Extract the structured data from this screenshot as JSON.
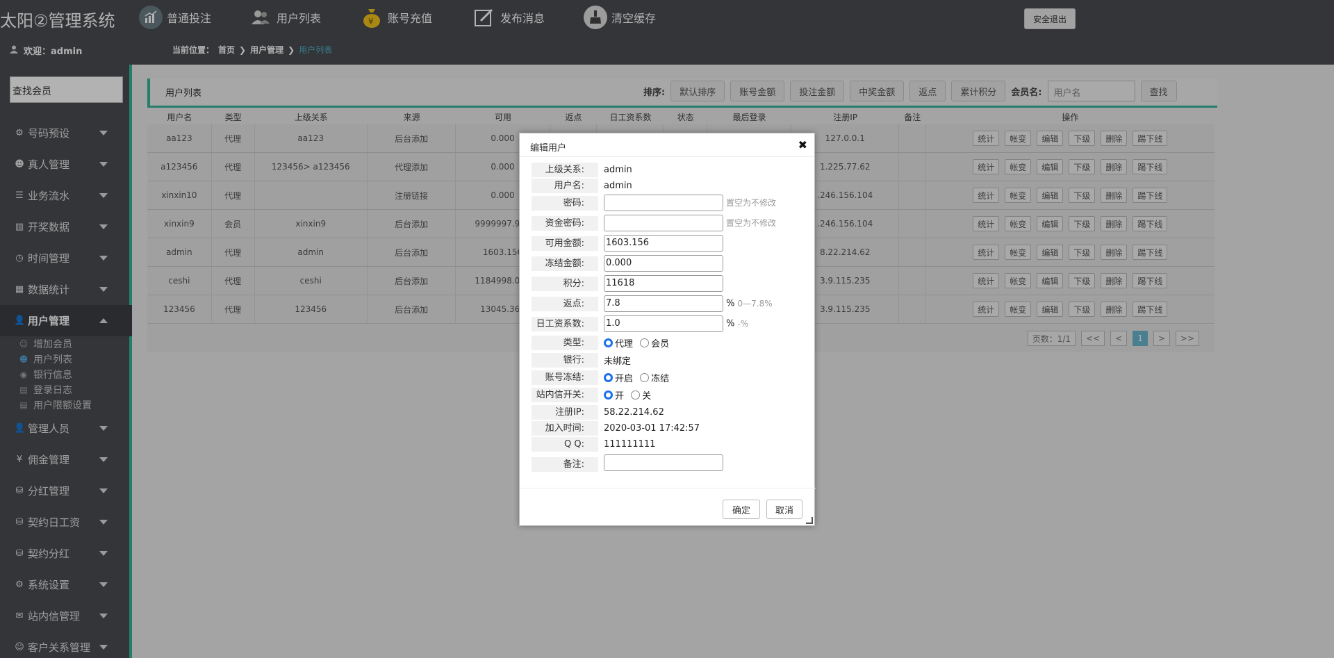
{
  "header": {
    "brand": "太阳②管理系统",
    "nav": [
      {
        "label": "普通投注",
        "icon": "chart-icon"
      },
      {
        "label": "用户列表",
        "icon": "users-icon"
      },
      {
        "label": "账号充值",
        "icon": "money-bag-icon"
      },
      {
        "label": "发布消息",
        "icon": "edit-icon"
      },
      {
        "label": "清空缓存",
        "icon": "broom-icon"
      }
    ],
    "logout": "安全退出",
    "welcome": "欢迎：admin",
    "breadcrumb": {
      "prefix": "当前位置：",
      "home": "首页",
      "section": "用户管理",
      "current": "用户列表"
    }
  },
  "sidebar": {
    "search_label": "查找会员",
    "menu": [
      {
        "label": "号码预设",
        "icon": "gear-icon"
      },
      {
        "label": "真人管理",
        "icon": "people-icon"
      },
      {
        "label": "业务流水",
        "icon": "list-icon"
      },
      {
        "label": "开奖数据",
        "icon": "bar-chart-icon"
      },
      {
        "label": "时间管理",
        "icon": "clock-icon"
      },
      {
        "label": "数据统计",
        "icon": "stats-icon"
      },
      {
        "label": "用户管理",
        "icon": "user-icon"
      },
      {
        "label": "管理人员",
        "icon": "admin-icon"
      },
      {
        "label": "佣金管理",
        "icon": "yen-icon"
      },
      {
        "label": "分红管理",
        "icon": "database-icon"
      },
      {
        "label": "契约日工资",
        "icon": "database-icon"
      },
      {
        "label": "契约分红",
        "icon": "database-icon"
      },
      {
        "label": "系统设置",
        "icon": "gear-icon"
      },
      {
        "label": "站内信管理",
        "icon": "mail-icon"
      },
      {
        "label": "客户关系管理",
        "icon": "contacts-icon"
      }
    ],
    "submenu": [
      {
        "label": "增加会员",
        "icon": "add-user-icon"
      },
      {
        "label": "用户列表",
        "icon": "user-icon"
      },
      {
        "label": "银行信息",
        "icon": "bank-icon"
      },
      {
        "label": "登录日志",
        "icon": "log-icon"
      },
      {
        "label": "用户限额设置",
        "icon": "limit-icon"
      }
    ]
  },
  "panel": {
    "title": "用户列表",
    "sort_label": "排序:",
    "sort_buttons": [
      "默认排序",
      "账号金额",
      "投注金额",
      "中奖金额",
      "返点",
      "累计积分"
    ],
    "member_label": "会员名:",
    "member_placeholder": "用户名",
    "search_button": "查找"
  },
  "table": {
    "headers": [
      "用户名",
      "类型",
      "上级关系",
      "来源",
      "可用",
      "返点",
      "日工资系数",
      "状态",
      "最后登录",
      "注册IP",
      "备注",
      "操作"
    ],
    "rows": [
      {
        "username": "aa123",
        "type": "代理",
        "parent": "aa123",
        "source": "后台添加",
        "balance": "0.000",
        "ip": "127.0.0.1"
      },
      {
        "username": "a123456",
        "type": "代理",
        "parent": "123456> a123456",
        "source": "代理添加",
        "balance": "0.000",
        "ip": "1.225.77.62"
      },
      {
        "username": "xinxin10",
        "type": "代理",
        "parent": "",
        "source": "注册链接",
        "balance": "0.000",
        "ip": ".246.156.104"
      },
      {
        "username": "xinxin9",
        "type": "会员",
        "parent": "xinxin9",
        "source": "后台添加",
        "balance": "9999997.999",
        "ip": ".246.156.104"
      },
      {
        "username": "admin",
        "type": "代理",
        "parent": "admin",
        "source": "后台添加",
        "balance": "1603.156",
        "ip": "8.22.214.62"
      },
      {
        "username": "ceshi",
        "type": "代理",
        "parent": "ceshi",
        "source": "后台添加",
        "balance": "1184998.000",
        "ip": "3.9.115.235"
      },
      {
        "username": "123456",
        "type": "代理",
        "parent": "123456",
        "source": "后台添加",
        "balance": "13045.360",
        "ip": "3.9.115.235"
      }
    ],
    "ops": [
      "统计",
      "帐变",
      "编辑",
      "下级",
      "删除",
      "踢下线"
    ]
  },
  "pager": {
    "info": "页数：1/1",
    "first": "<<",
    "prev": "<",
    "page": "1",
    "next": ">",
    "last": ">>"
  },
  "modal": {
    "title": "编辑用户",
    "close": "✖",
    "parent_label": "上级关系:",
    "parent_value": "admin",
    "username_label": "用户名:",
    "username_value": "admin",
    "password_label": "密码:",
    "password_hint": "置空为不修改",
    "fund_password_label": "资金密码:",
    "fund_password_hint": "置空为不修改",
    "available_label": "可用金额:",
    "available_value": "1603.156",
    "frozen_label": "冻结金额:",
    "frozen_value": "0.000",
    "points_label": "积分:",
    "points_value": "11618",
    "rebate_label": "返点:",
    "rebate_value": "7.8",
    "rebate_unit": "%",
    "rebate_hint": "0—7.8%",
    "wage_label": "日工资系数:",
    "wage_value": "1.0",
    "wage_unit": "%",
    "wage_hint": "-%",
    "type_label": "类型:",
    "type_options": [
      "代理",
      "会员"
    ],
    "bank_label": "银行:",
    "bank_value": "未绑定",
    "freeze_label": "账号冻结:",
    "freeze_options": [
      "开启",
      "冻结"
    ],
    "msg_label": "站内信开关:",
    "msg_options": [
      "开",
      "关"
    ],
    "regip_label": "注册IP:",
    "regip_value": "58.22.214.62",
    "jointime_label": "加入时间:",
    "jointime_value": "2020-03-01 17:42:57",
    "qq_label": "Q Q:",
    "qq_value": "111111111",
    "remark_label": "备注:",
    "confirm": "确定",
    "cancel": "取消"
  }
}
